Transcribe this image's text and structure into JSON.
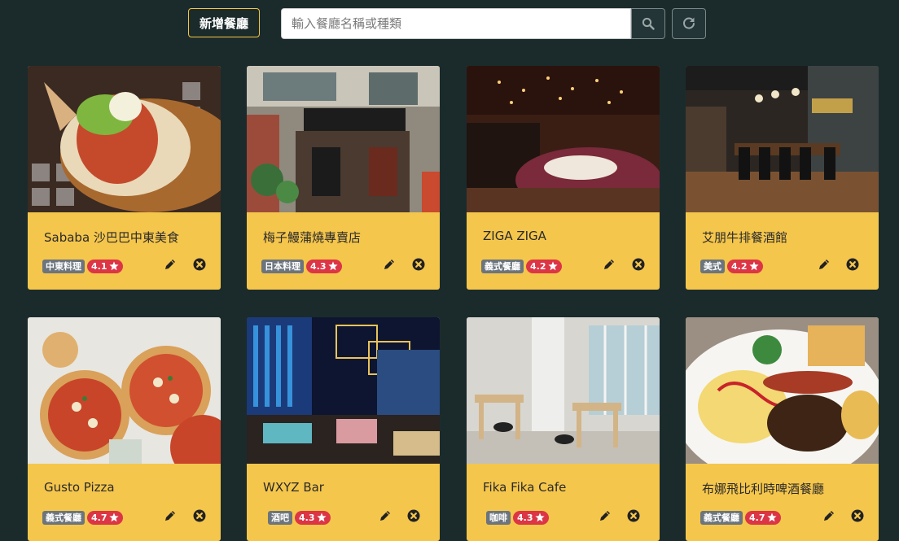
{
  "toolbar": {
    "add_label": "新增餐廳",
    "search_placeholder": "輸入餐廳名稱或種類",
    "search_value": ""
  },
  "colors": {
    "background": "#1b2b2c",
    "card": "#f5c64c",
    "accent_border": "#f5c542",
    "category_badge": "#6c757d",
    "rating_badge": "#dc3545"
  },
  "restaurants": [
    {
      "name": "Sababa 沙巴巴中東美食",
      "category": "中東料理",
      "rating": "4.1"
    },
    {
      "name": "梅子鰻蒲燒專賣店",
      "category": "日本料理",
      "rating": "4.3"
    },
    {
      "name": "ZIGA ZIGA",
      "category": "義式餐廳",
      "rating": "4.2"
    },
    {
      "name": "艾朋牛排餐酒館",
      "category": "美式",
      "rating": "4.2"
    },
    {
      "name": "Gusto Pizza",
      "category": "義式餐廳",
      "rating": "4.7"
    },
    {
      "name": "WXYZ Bar",
      "category": "酒吧",
      "rating": "4.3"
    },
    {
      "name": "Fika Fika Cafe",
      "category": "咖啡",
      "rating": "4.3"
    },
    {
      "name": "布娜飛比利時啤酒餐廳",
      "category": "義式餐廳",
      "rating": "4.7"
    }
  ],
  "icons": {
    "search": "search-icon",
    "refresh": "refresh-icon",
    "star": "star-icon",
    "edit": "pencil-icon",
    "delete": "close-circle-icon"
  }
}
